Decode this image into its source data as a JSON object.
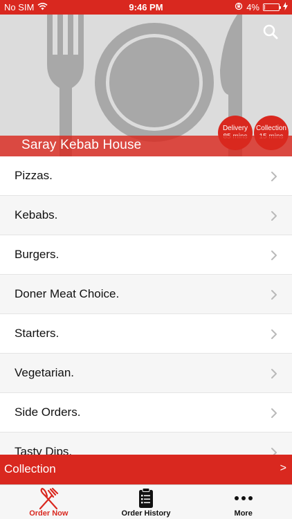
{
  "status_bar": {
    "carrier": "No SIM",
    "time": "9:46 PM",
    "battery_percent_label": "4%",
    "battery_level": 0.04
  },
  "header": {
    "restaurant_name": "Saray Kebab House",
    "search_icon": "search-icon",
    "delivery_badge": {
      "title": "Delivery",
      "time": "85 mins"
    },
    "collection_badge": {
      "title": "Collection",
      "time": "15 mins"
    }
  },
  "menu": {
    "items": [
      {
        "label": "Pizzas."
      },
      {
        "label": "Kebabs."
      },
      {
        "label": "Burgers."
      },
      {
        "label": "Doner Meat Choice."
      },
      {
        "label": "Starters."
      },
      {
        "label": "Vegetarian."
      },
      {
        "label": "Side Orders."
      },
      {
        "label": "Tasty Dips."
      }
    ],
    "chevron_icon": "chevron-right-icon"
  },
  "collection_bar": {
    "label": "Collection",
    "arrow": ">"
  },
  "tab_bar": {
    "tabs": [
      {
        "label": "Order Now",
        "icon": "fork-knife-icon",
        "active": true
      },
      {
        "label": "Order History",
        "icon": "clipboard-icon",
        "active": false
      },
      {
        "label": "More",
        "icon": "more-dots-icon",
        "active": false
      }
    ]
  },
  "colors": {
    "brand_red": "#d9281f",
    "hero_gray": "#dcdcdc"
  }
}
